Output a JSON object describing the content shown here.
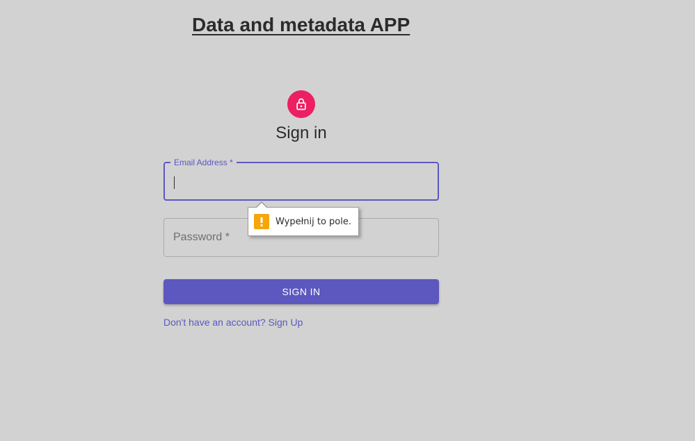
{
  "app": {
    "title": "Data and metadata APP"
  },
  "icons": {
    "lock": "lock-outlined-icon",
    "warning": "exclamation-warning-icon"
  },
  "form": {
    "heading": "Sign in",
    "email": {
      "label": "Email Address *",
      "value": ""
    },
    "password": {
      "placeholder": "Password *",
      "value": ""
    },
    "submit_label": "SIGN IN",
    "signup_link": "Don't have an account? Sign Up"
  },
  "validation_tooltip": {
    "message": "Wypełnij to pole."
  },
  "colors": {
    "background": "#d2d2d2",
    "primary": "#5c58bf",
    "avatar": "#ec1f63",
    "warning": "#f6a609"
  }
}
